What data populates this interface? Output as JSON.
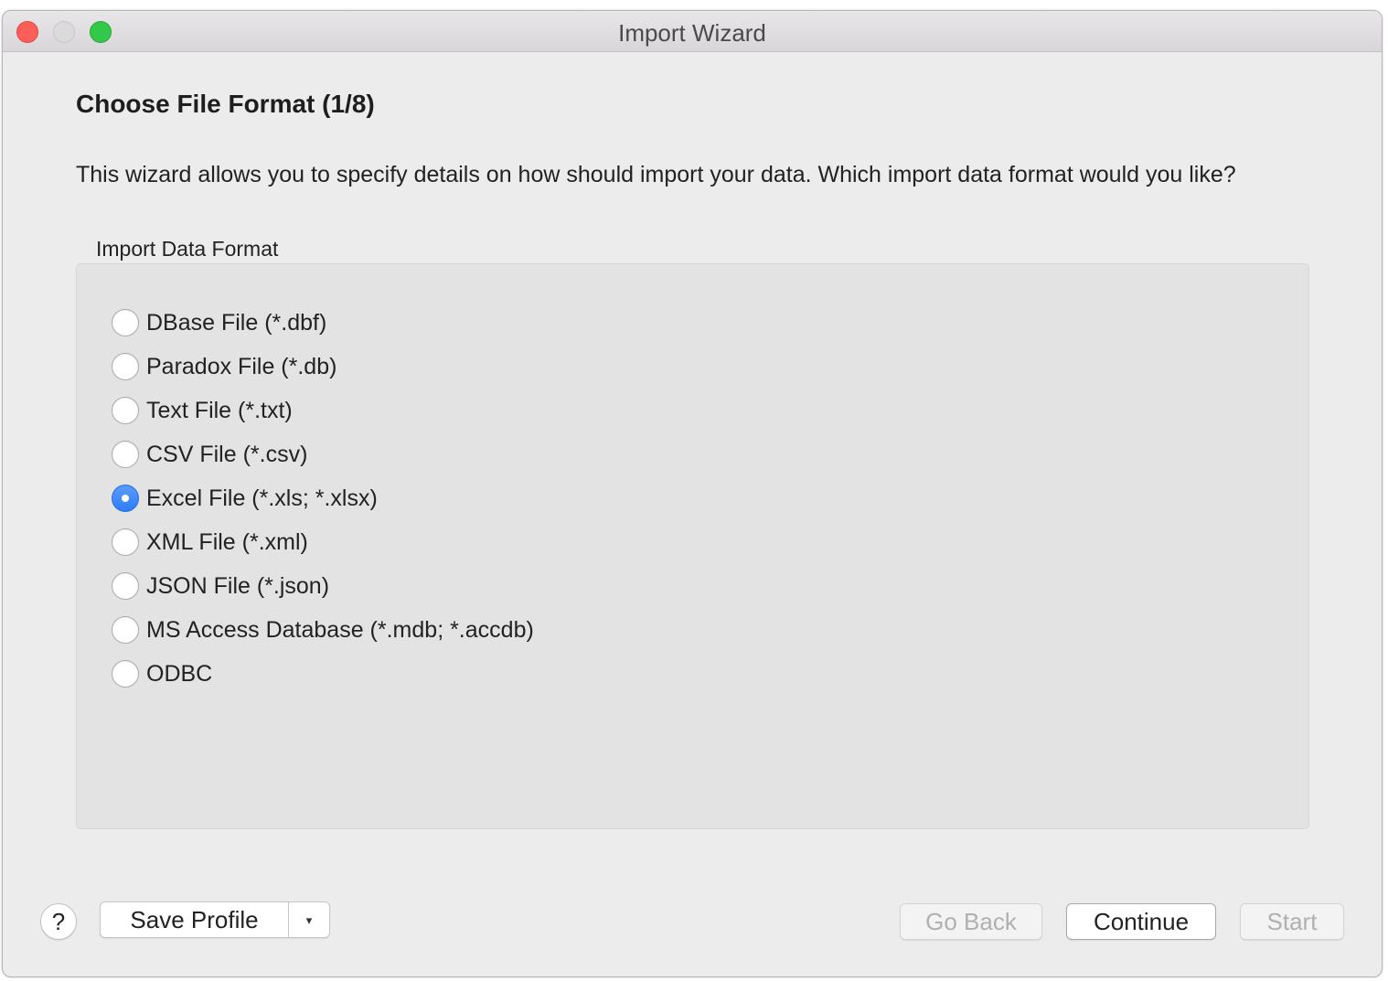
{
  "window": {
    "title": "Import Wizard"
  },
  "page": {
    "heading": "Choose File Format (1/8)",
    "description": "This wizard allows you to specify details on how should import your data. Which import data format would you like?"
  },
  "format_group": {
    "label": "Import Data Format",
    "selected_index": 4,
    "options": [
      {
        "label": "DBase File (*.dbf)",
        "selected": false
      },
      {
        "label": "Paradox File (*.db)",
        "selected": false
      },
      {
        "label": "Text File (*.txt)",
        "selected": false
      },
      {
        "label": "CSV File (*.csv)",
        "selected": false
      },
      {
        "label": "Excel File (*.xls; *.xlsx)",
        "selected": true
      },
      {
        "label": "XML File (*.xml)",
        "selected": false
      },
      {
        "label": "JSON File (*.json)",
        "selected": false
      },
      {
        "label": "MS Access Database (*.mdb; *.accdb)",
        "selected": false
      },
      {
        "label": "ODBC",
        "selected": false
      }
    ]
  },
  "footer": {
    "help_label": "?",
    "save_profile_label": "Save Profile",
    "dropdown_arrow": "▾",
    "go_back_label": "Go Back",
    "continue_label": "Continue",
    "start_label": "Start",
    "go_back_enabled": false,
    "start_enabled": false
  },
  "colors": {
    "accent": "#2f7cf6",
    "close": "#fc5f57",
    "zoom": "#34c84a",
    "window_bg": "#ececec",
    "group_bg": "#e3e3e3"
  }
}
